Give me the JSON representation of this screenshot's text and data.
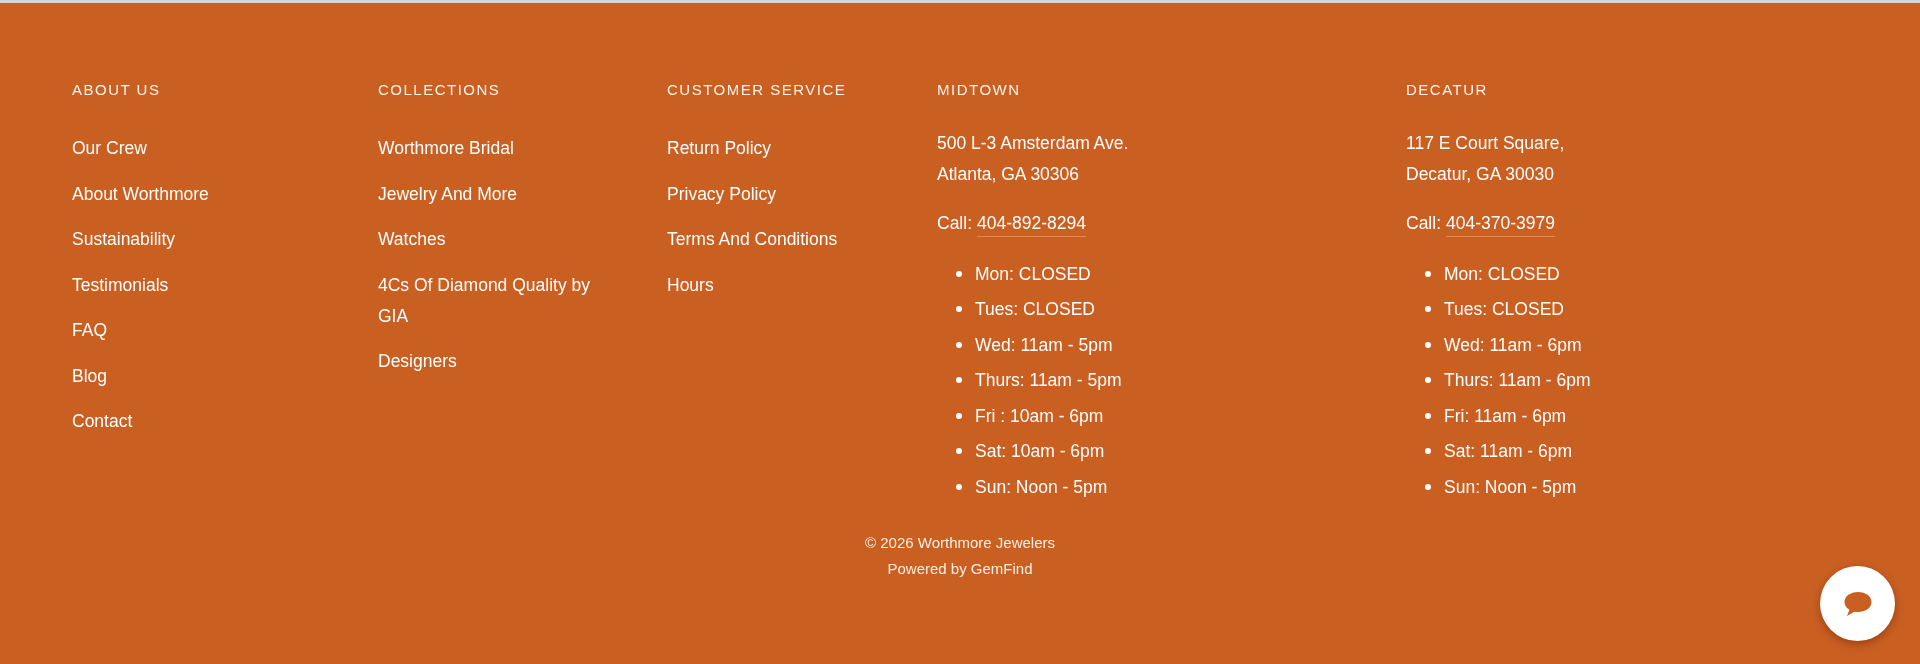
{
  "link_columns": [
    {
      "heading": "ABOUT US",
      "links": [
        "Our Crew",
        "About Worthmore",
        "Sustainability",
        "Testimonials",
        "FAQ",
        "Blog",
        "Contact"
      ]
    },
    {
      "heading": "COLLECTIONS",
      "links": [
        "Worthmore Bridal",
        "Jewelry And More",
        "Watches",
        "4Cs Of Diamond Quality by GIA",
        "Designers"
      ]
    },
    {
      "heading": "CUSTOMER SERVICE",
      "links": [
        "Return Policy",
        "Privacy Policy",
        "Terms And Conditions",
        "Hours"
      ]
    }
  ],
  "locations": [
    {
      "name": "MIDTOWN",
      "address": [
        "500 L-3 Amsterdam Ave.",
        "Atlanta, GA 30306"
      ],
      "call_label": "Call:",
      "phone": "404-892-8294",
      "hours": [
        "Mon: CLOSED",
        "Tues: CLOSED",
        "Wed: 11am - 5pm",
        "Thurs: 11am - 5pm",
        "Fri : 10am - 6pm",
        "Sat: 10am - 6pm",
        "Sun: Noon - 5pm"
      ]
    },
    {
      "name": "DECATUR",
      "address": [
        "117 E Court Square,",
        "Decatur, GA 30030"
      ],
      "call_label": "Call:",
      "phone": "404-370-3979",
      "hours": [
        "Mon: CLOSED",
        "Tues: CLOSED",
        "Wed: 11am - 6pm",
        "Thurs: 11am - 6pm",
        "Fri: 11am - 6pm",
        "Sat: 11am - 6pm",
        "Sun: Noon - 5pm"
      ]
    }
  ],
  "footer": {
    "copyright": "© 2026 Worthmore Jewelers",
    "powered_by": "Powered by GemFind"
  }
}
